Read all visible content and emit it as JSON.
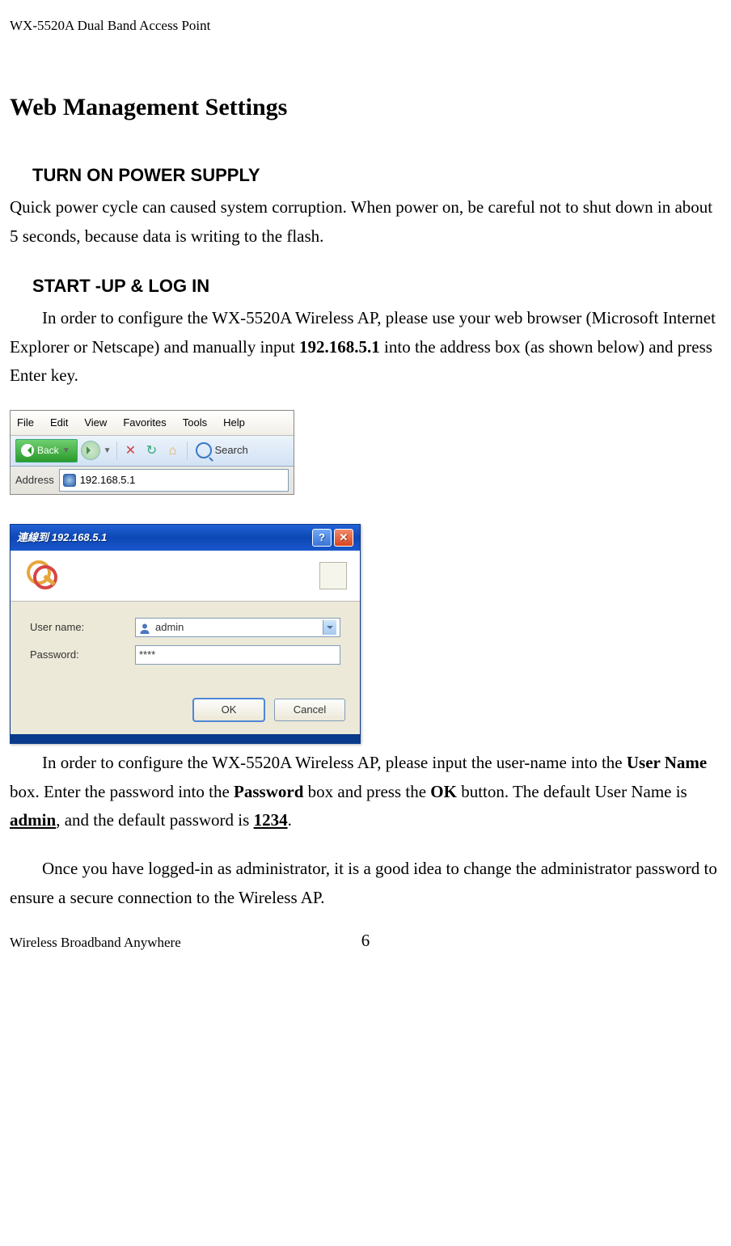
{
  "header": "WX-5520A Dual Band Access Point",
  "title": "Web Management Settings",
  "section1": {
    "heading": "TURN ON POWER SUPPLY",
    "text": "Quick power cycle can caused system corruption. When power on, be careful not to shut down in about 5 seconds, because data is writing to the flash."
  },
  "section2": {
    "heading": "START -UP & LOG IN",
    "text_pre": "In order to configure the WX-5520A Wireless AP, please use your web browser (Microsoft Internet Explorer or Netscape) and manually input ",
    "ip_bold": "192.168.5.1",
    "text_post": " into the address box (as shown below) and press Enter key."
  },
  "browser": {
    "menus": [
      "File",
      "Edit",
      "View",
      "Favorites",
      "Tools",
      "Help"
    ],
    "back_label": "Back",
    "search_label": "Search",
    "address_label": "Address",
    "address_value": "192.168.5.1"
  },
  "login_dialog": {
    "title": "連線到 192.168.5.1",
    "username_label": "User name:",
    "password_label": "Password:",
    "username_value": "admin",
    "password_value": "****",
    "ok": "OK",
    "cancel": "Cancel"
  },
  "under_login": {
    "p1_a": "In order to configure the WX-5520A Wireless AP, please input the user-name into the ",
    "p1_b": "User Name",
    "p1_c": " box. Enter the password into the ",
    "p1_d": "Password",
    "p1_e": " box and press the ",
    "p1_f": "OK",
    "p1_g": " button. The default User Name is ",
    "p1_h": "admin",
    "p1_i": ", and the default password is ",
    "p1_j": "1234",
    "p1_k": ".",
    "p2": "Once you have logged-in as administrator, it is a good idea to change the administrator password to ensure a secure connection to the Wireless AP."
  },
  "footer": {
    "left": "Wireless Broadband Anywhere",
    "page": "6"
  }
}
